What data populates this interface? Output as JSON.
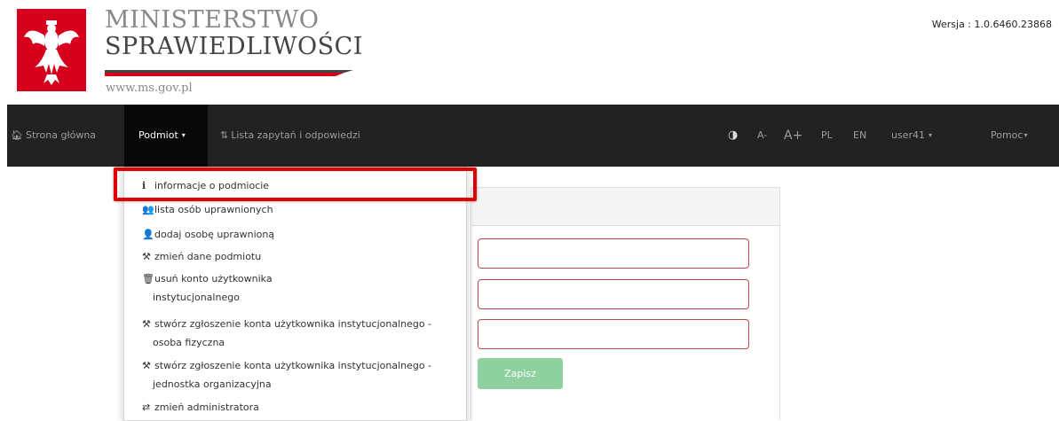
{
  "header": {
    "title": "MINISTERSTWO",
    "subtitle": "SPRAWIEDLIWOŚCI",
    "url": "www.ms.gov.pl",
    "version": "Wersja : 1.0.6460.23868"
  },
  "navbar": {
    "home": "Strona główna",
    "subject": "Podmiot",
    "queries": "Lista zapytań i odpowiedzi",
    "contrast_icon": "◑",
    "font_smaller": "A-",
    "font_larger": "A+",
    "lang_pl": "PL",
    "lang_en": "EN",
    "user": "user41",
    "help": "Pomoc"
  },
  "dropdown": {
    "items": [
      {
        "icon": "info-icon",
        "glyph": "i",
        "label": "informacje o podmiocie"
      },
      {
        "icon": "users-icon",
        "glyph": "👥",
        "label": "lista osób uprawnionych"
      },
      {
        "icon": "add-user-icon",
        "glyph": "👤",
        "label": "dodaj osobę uprawnioną"
      },
      {
        "icon": "gavel-icon",
        "glyph": "⚒",
        "label": "zmień dane podmiotu"
      },
      {
        "icon": "trash-icon",
        "glyph": "🗑",
        "label": "usuń konto użytkownika",
        "label2": "instytucjonalnego"
      },
      {
        "icon": "gavel-icon",
        "glyph": "⚒",
        "label": "stwórz zgłoszenie konta użytkownika instytucjonalnego -",
        "label2": "osoba fizyczna"
      },
      {
        "icon": "gavel-icon",
        "glyph": "⚒",
        "label": "stwórz zgłoszenie konta użytkownika instytucjonalnego -",
        "label2": "jednostka organizacyjna"
      },
      {
        "icon": "random-icon",
        "glyph": "⇄",
        "label": "zmień administratora"
      }
    ]
  },
  "form": {
    "save_label": "Zapisz"
  },
  "colors": {
    "navbar": "#222222",
    "highlight": "#e00000",
    "field_border": "#b94a48",
    "save_button": "#8fd19e"
  }
}
